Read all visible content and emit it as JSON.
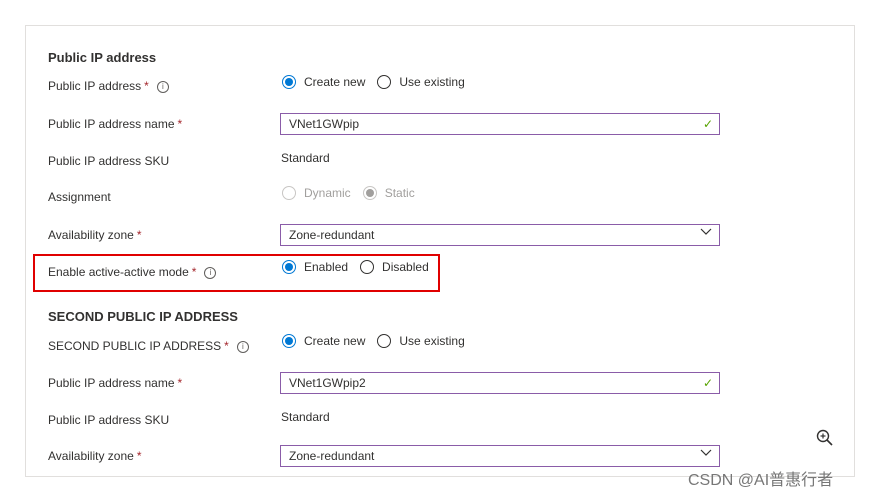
{
  "section1": {
    "title": "Public IP address",
    "public_ip": {
      "label": "Public IP address",
      "required_mark": "*",
      "options": [
        "Create new",
        "Use existing"
      ],
      "selected": "Create new"
    },
    "ip_name": {
      "label": "Public IP address name",
      "required_mark": "*",
      "value": "VNet1GWpip"
    },
    "sku": {
      "label": "Public IP address SKU",
      "value": "Standard"
    },
    "assignment": {
      "label": "Assignment",
      "options": [
        "Dynamic",
        "Static"
      ],
      "selected": "Static"
    },
    "zone": {
      "label": "Availability zone",
      "required_mark": "*",
      "value": "Zone-redundant"
    },
    "active_active": {
      "label": "Enable active-active mode",
      "required_mark": "*",
      "options": [
        "Enabled",
        "Disabled"
      ],
      "selected": "Enabled"
    }
  },
  "section2": {
    "title": "SECOND PUBLIC IP ADDRESS",
    "public_ip": {
      "label": "SECOND PUBLIC IP ADDRESS",
      "required_mark": "*",
      "options": [
        "Create new",
        "Use existing"
      ],
      "selected": "Create new"
    },
    "ip_name": {
      "label": "Public IP address name",
      "required_mark": "*",
      "value": "VNet1GWpip2"
    },
    "sku": {
      "label": "Public IP address SKU",
      "value": "Standard"
    },
    "zone": {
      "label": "Availability zone",
      "required_mark": "*",
      "value": "Zone-redundant"
    }
  },
  "icons": {
    "info": "info-icon",
    "check": "checkmark-icon",
    "chevron": "chevron-down-icon",
    "zoom": "zoom-in-icon"
  },
  "colors": {
    "accent": "#0078d4",
    "field_border": "#8a5ca8",
    "valid_check": "#57a300",
    "required": "#a4262c",
    "highlight": "#e00000"
  },
  "watermark": "CSDN @AI普惠行者"
}
